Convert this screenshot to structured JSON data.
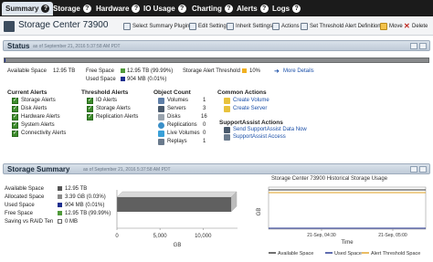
{
  "tabs": [
    {
      "label": "Summary"
    },
    {
      "label": "Storage"
    },
    {
      "label": "Hardware"
    },
    {
      "label": "IO Usage"
    },
    {
      "label": "Charting"
    },
    {
      "label": "Alerts"
    },
    {
      "label": "Logs"
    }
  ],
  "title": "Storage Center 73900",
  "toolbar": {
    "select_plugins": "Select Summary Plugins",
    "edit_settings": "Edit Settings",
    "inherit_settings": "Inherit Settings",
    "actions": "Actions",
    "threshold": "Set Threshold Alert Definitions",
    "move": "Move",
    "delete": "Delete"
  },
  "status": {
    "header": "Status",
    "date": "as of September 21, 2016 5:37:58 AM PDT",
    "available_space_label": "Available Space",
    "available_space_value": "12.95 TB",
    "free_space_label": "Free Space",
    "free_space_value": "12.95 TB (99.99%)",
    "used_space_label": "Used Space",
    "used_space_value": "904 MB (0.01%)",
    "threshold_label": "Storage Alert Threshold",
    "threshold_value": "10%",
    "more_details": "More Details",
    "used_fraction": 0.0001
  },
  "current_alerts": {
    "heading": "Current Alerts",
    "items": [
      "Storage Alerts",
      "Disk Alerts",
      "Hardware Alerts",
      "System Alerts",
      "Connectivity Alerts"
    ]
  },
  "threshold_alerts": {
    "heading": "Threshold Alerts",
    "items": [
      "IO Alerts",
      "Storage Alerts",
      "Replication Alerts"
    ]
  },
  "object_count": {
    "heading": "Object Count",
    "items": [
      {
        "label": "Volumes",
        "value": "1"
      },
      {
        "label": "Servers",
        "value": "3"
      },
      {
        "label": "Disks",
        "value": "16"
      },
      {
        "label": "Replications",
        "value": "0"
      },
      {
        "label": "Live Volumes",
        "value": "0"
      },
      {
        "label": "Replays",
        "value": "1"
      }
    ]
  },
  "common_actions": {
    "heading": "Common Actions",
    "items": [
      "Create Volume",
      "Create Server"
    ]
  },
  "supportassist": {
    "heading": "SupportAssist Actions",
    "items": [
      "Send SupportAssist Data Now",
      "SupportAssist Access"
    ]
  },
  "storage_summary": {
    "header": "Storage Summary",
    "date": "as of September 21, 2016 5:37:58 AM PDT",
    "rows": [
      {
        "label": "Available Space",
        "value": "12.95 TB",
        "color": "#555555"
      },
      {
        "label": "Allocated Space",
        "value": "3.39 GB (0.03%)",
        "color": "#8a8a8a"
      },
      {
        "label": "Used Space",
        "value": "904 MB (0.01%)",
        "color": "#1d2f8f"
      },
      {
        "label": "Free Space",
        "value": "12.95 TB (99.99%)",
        "color": "#4f9a3a"
      },
      {
        "label": "Saving vs RAID Ten",
        "value": "0 MB",
        "color": "#ffffff"
      }
    ]
  },
  "chart_data": [
    {
      "type": "bar",
      "title": "",
      "xlabel": "GB",
      "ylabel": "",
      "x_ticks": [
        "0",
        "5,000",
        "10,000"
      ],
      "xlim": [
        0,
        14000
      ],
      "series": [
        {
          "name": "Available Space",
          "values": [
            13261
          ]
        }
      ]
    },
    {
      "type": "line",
      "title": "Storage Center 73900 Historical Storage Usage",
      "xlabel": "Time",
      "ylabel": "GB",
      "x_ticks": [
        "21-Sep, 04:30",
        "21-Sep, 05:00"
      ],
      "series": [
        {
          "name": "Available Space",
          "color": "#333333"
        },
        {
          "name": "Used Space",
          "color": "#1d2f8f"
        },
        {
          "name": "Alert Threshold Space",
          "color": "#e0a020"
        }
      ]
    }
  ]
}
